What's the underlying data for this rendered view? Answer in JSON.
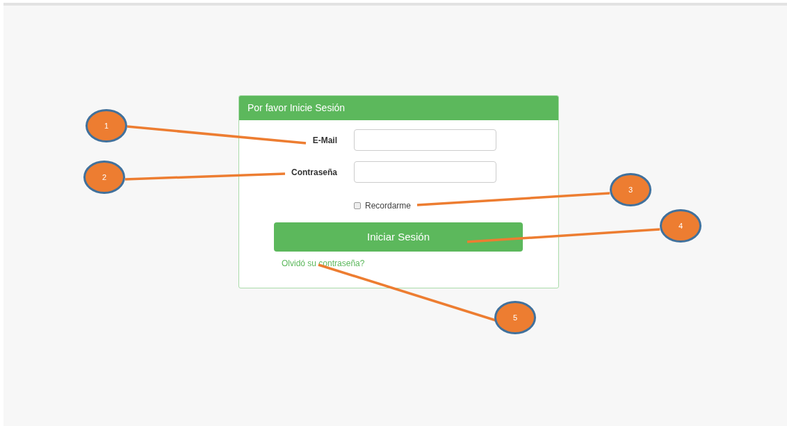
{
  "panel": {
    "title": "Por favor Inicie Sesión"
  },
  "fields": [
    {
      "label": "E-Mail"
    },
    {
      "label": "Contraseña"
    }
  ],
  "remember": {
    "label": "Recordarme",
    "checked": false
  },
  "submit_button": "Iniciar Sesión",
  "forgot_link": "Olvidó su contraseña?",
  "callouts": [
    {
      "label": "1"
    },
    {
      "label": "2"
    },
    {
      "label": "3"
    },
    {
      "label": "4"
    },
    {
      "label": "5"
    }
  ]
}
